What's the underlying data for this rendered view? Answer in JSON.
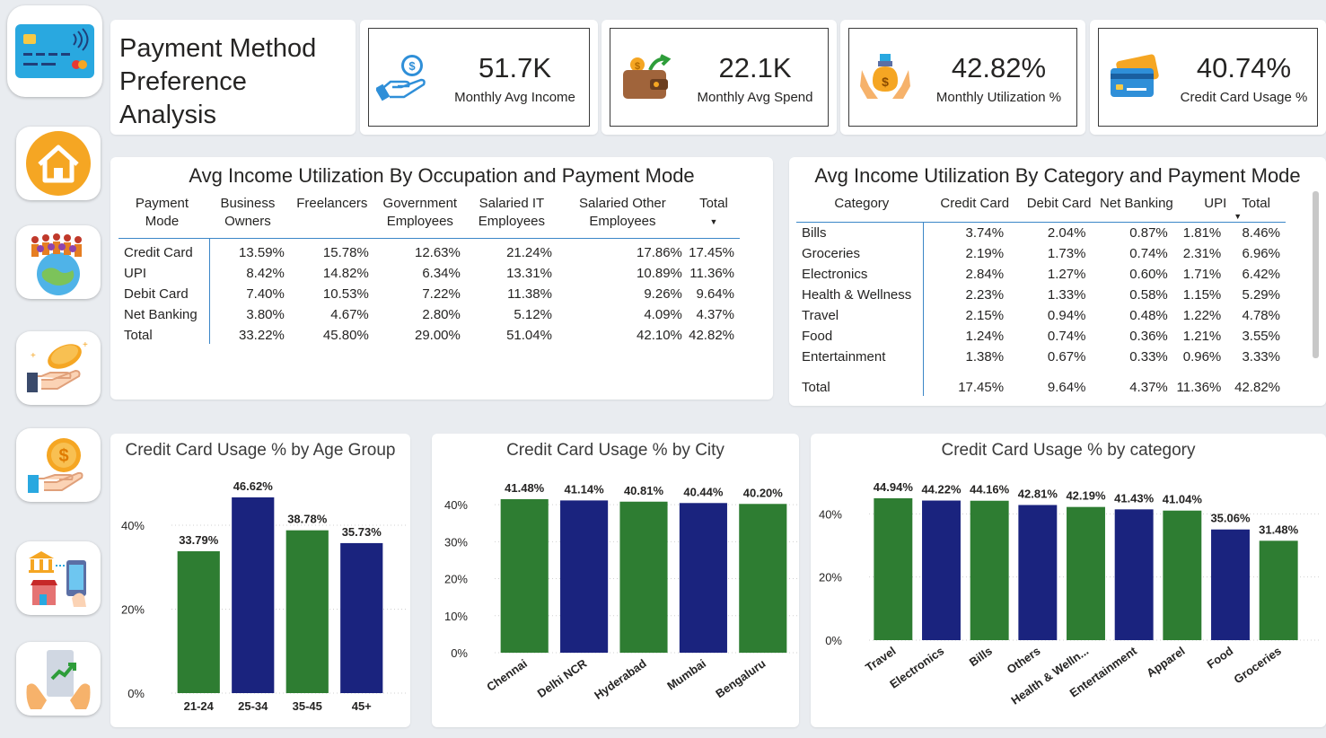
{
  "header": {
    "title_line1": "Payment Method",
    "title_line2": "Preference Analysis"
  },
  "kpis": [
    {
      "value": "51.7K",
      "label": "Monthly Avg Income",
      "icon": "hand-coin-icon"
    },
    {
      "value": "22.1K",
      "label": "Monthly Avg Spend",
      "icon": "wallet-icon"
    },
    {
      "value": "42.82%",
      "label": "Monthly Utilization %",
      "icon": "hands-money-bag-icon"
    },
    {
      "value": "40.74%",
      "label": "Credit Card Usage %",
      "icon": "credit-cards-icon"
    }
  ],
  "nav": {
    "items": [
      "credit-card-logo-icon",
      "home-icon",
      "people-globe-icon",
      "coin-hand-icon",
      "dollar-hand-icon",
      "bank-mobile-icon",
      "growth-phone-icon"
    ]
  },
  "occupation_matrix": {
    "title": "Avg Income Utilization By Occupation and Payment Mode",
    "headers": [
      [
        "Payment",
        "Mode"
      ],
      [
        "Business",
        "Owners"
      ],
      [
        "Freelancers",
        ""
      ],
      [
        "Government",
        "Employees"
      ],
      [
        "Salaried IT",
        "Employees"
      ],
      [
        "Salaried Other",
        "Employees"
      ],
      [
        "Total",
        ""
      ]
    ],
    "rows": [
      [
        "Credit Card",
        "13.59%",
        "15.78%",
        "12.63%",
        "21.24%",
        "17.86%",
        "17.45%"
      ],
      [
        "UPI",
        "8.42%",
        "14.82%",
        "6.34%",
        "13.31%",
        "10.89%",
        "11.36%"
      ],
      [
        "Debit Card",
        "7.40%",
        "10.53%",
        "7.22%",
        "11.38%",
        "9.26%",
        "9.64%"
      ],
      [
        "Net Banking",
        "3.80%",
        "4.67%",
        "2.80%",
        "5.12%",
        "4.09%",
        "4.37%"
      ],
      [
        "Total",
        "33.22%",
        "45.80%",
        "29.00%",
        "51.04%",
        "42.10%",
        "42.82%"
      ]
    ]
  },
  "category_matrix": {
    "title": "Avg Income Utilization By Category and Payment Mode",
    "headers": [
      "Category",
      "Credit Card",
      "Debit Card",
      "Net Banking",
      "UPI",
      "Total"
    ],
    "rows": [
      [
        "Bills",
        "3.74%",
        "2.04%",
        "0.87%",
        "1.81%",
        "8.46%"
      ],
      [
        "Groceries",
        "2.19%",
        "1.73%",
        "0.74%",
        "2.31%",
        "6.96%"
      ],
      [
        "Electronics",
        "2.84%",
        "1.27%",
        "0.60%",
        "1.71%",
        "6.42%"
      ],
      [
        "Health & Wellness",
        "2.23%",
        "1.33%",
        "0.58%",
        "1.15%",
        "5.29%"
      ],
      [
        "Travel",
        "2.15%",
        "0.94%",
        "0.48%",
        "1.22%",
        "4.78%"
      ],
      [
        "Food",
        "1.24%",
        "0.74%",
        "0.36%",
        "1.21%",
        "3.55%"
      ],
      [
        "Entertainment",
        "1.38%",
        "0.67%",
        "0.33%",
        "0.96%",
        "3.33%"
      ]
    ],
    "total": [
      "Total",
      "17.45%",
      "9.64%",
      "4.37%",
      "11.36%",
      "42.82%"
    ]
  },
  "colors": {
    "green": "#2e7d32",
    "navy": "#1a237e",
    "accent_orange": "#f5a623"
  },
  "chart_data": [
    {
      "type": "bar",
      "title": "Credit Card Usage % by Age Group",
      "categories": [
        "21-24",
        "25-34",
        "35-45",
        "45+"
      ],
      "values": [
        33.79,
        46.62,
        38.78,
        35.73
      ],
      "labels": [
        "33.79%",
        "46.62%",
        "38.78%",
        "35.73%"
      ],
      "yticks": [
        "0%",
        "20%",
        "40%"
      ],
      "ylim": [
        0,
        49
      ]
    },
    {
      "type": "bar",
      "title": "Credit Card Usage % by City",
      "categories": [
        "Chennai",
        "Delhi NCR",
        "Hyderabad",
        "Mumbai",
        "Bengaluru"
      ],
      "values": [
        41.48,
        41.14,
        40.81,
        40.44,
        40.2
      ],
      "labels": [
        "41.48%",
        "41.14%",
        "40.81%",
        "40.44%",
        "40.20%"
      ],
      "yticks": [
        "0%",
        "10%",
        "20%",
        "30%",
        "40%"
      ],
      "ylim": [
        0,
        42
      ]
    },
    {
      "type": "bar",
      "title": "Credit Card Usage % by category",
      "categories": [
        "Travel",
        "Electronics",
        "Bills",
        "Others",
        "Health & Welln...",
        "Entertainment",
        "Apparel",
        "Food",
        "Groceries"
      ],
      "values": [
        44.94,
        44.22,
        44.16,
        42.81,
        42.19,
        41.43,
        41.04,
        35.06,
        31.48
      ],
      "labels": [
        "44.94%",
        "44.22%",
        "44.16%",
        "42.81%",
        "42.19%",
        "41.43%",
        "41.04%",
        "35.06%",
        "31.48%"
      ],
      "yticks": [
        "0%",
        "20%",
        "40%"
      ],
      "ylim": [
        0,
        46
      ]
    }
  ]
}
